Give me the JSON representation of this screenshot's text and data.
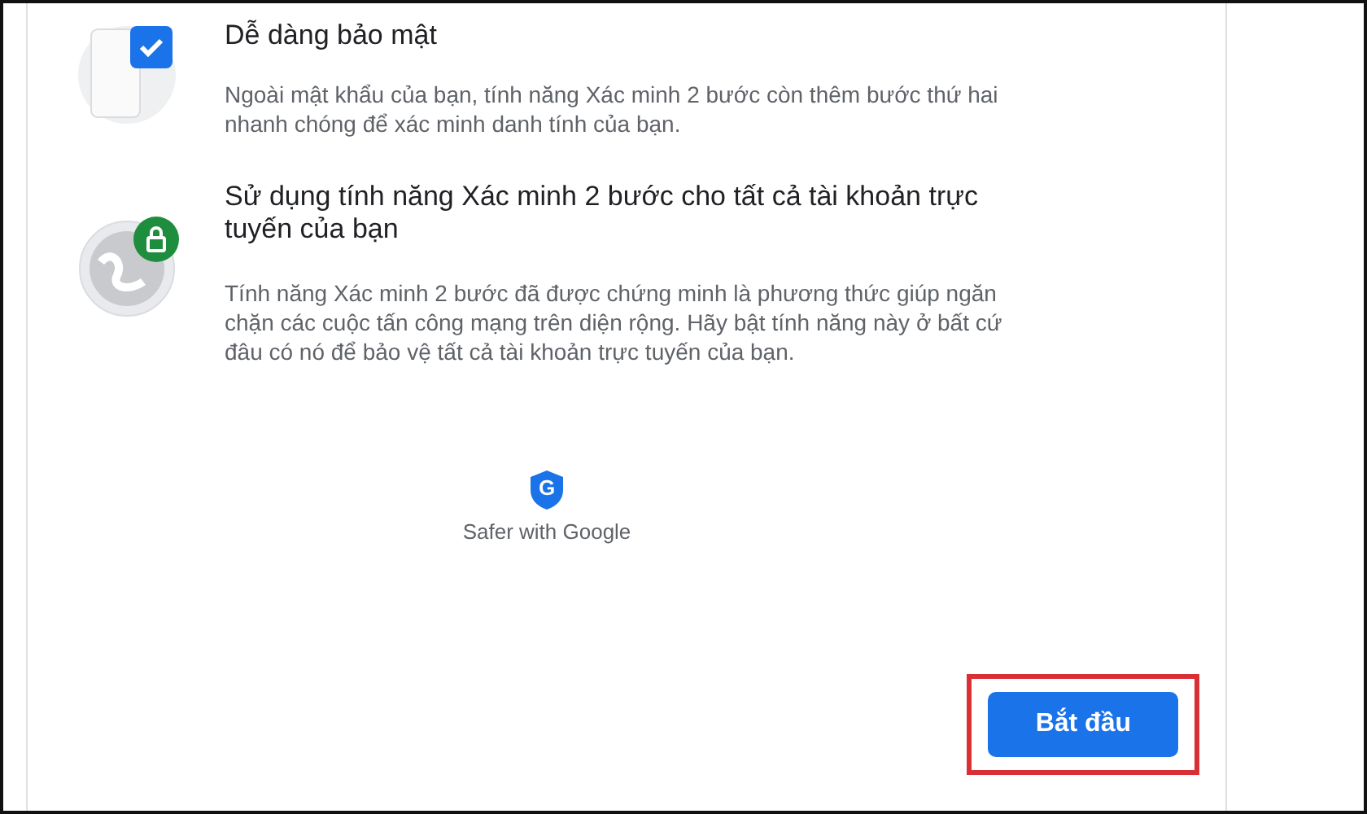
{
  "features": [
    {
      "kind": "check",
      "title": "Dễ dàng bảo mật",
      "body": "Ngoài mật khẩu của bạn, tính năng Xác minh 2 bước còn thêm bước thứ hai nhanh chóng để xác minh danh tính của bạn."
    },
    {
      "kind": "lock",
      "title": "Sử dụng tính năng Xác minh 2 bước cho tất cả tài khoản trực tuyến của bạn",
      "body": "Tính năng Xác minh 2 bước đã được chứng minh là phương thức giúp ngăn chặn các cuộc tấn công mạng trên diện rộng. Hãy bật tính năng này ở bất cứ đâu có nó để bảo vệ tất cả tài khoản trực tuyến của bạn."
    }
  ],
  "badge": {
    "letter": "G",
    "caption": "Safer with Google"
  },
  "button": {
    "label": "Bắt đầu",
    "highlighted": true
  }
}
